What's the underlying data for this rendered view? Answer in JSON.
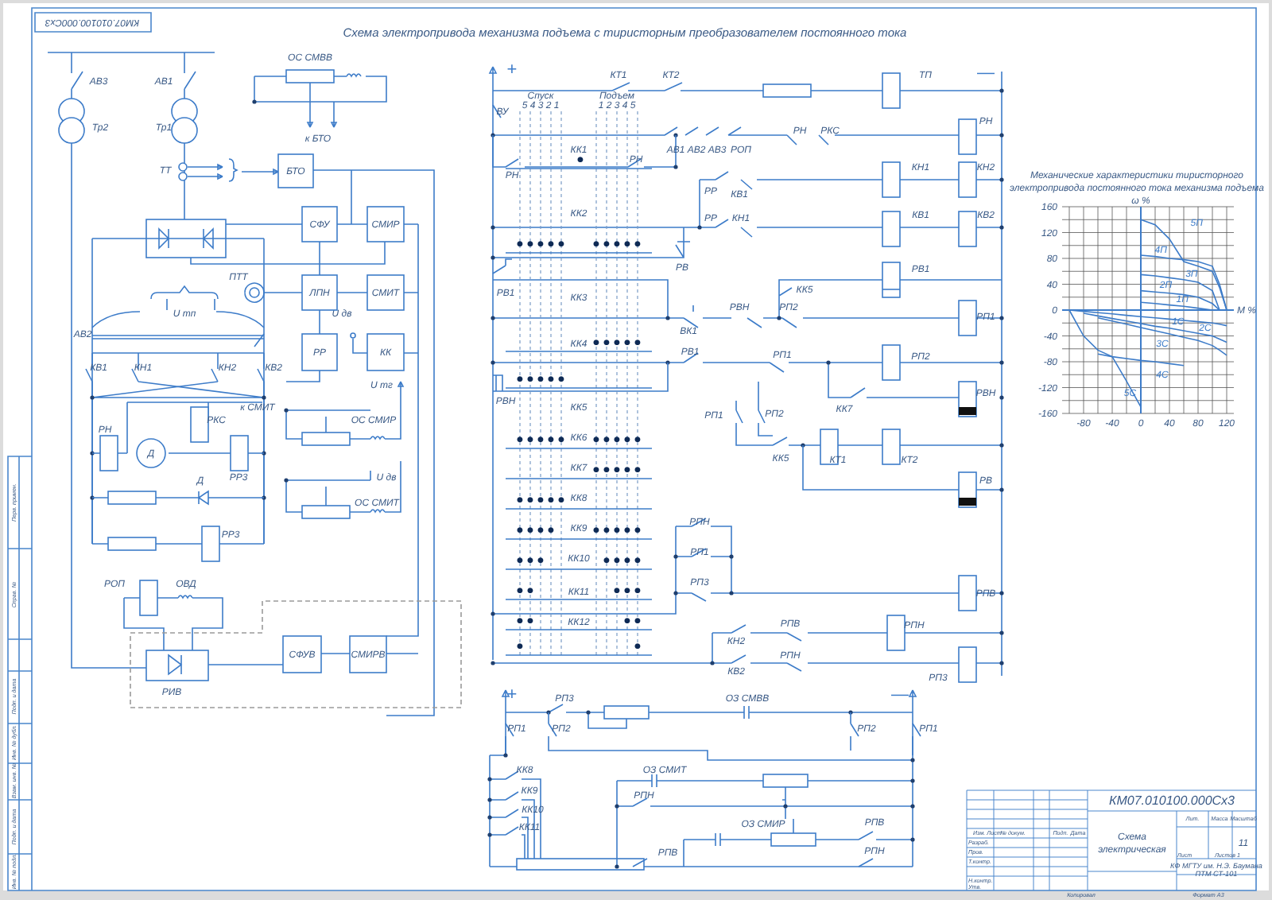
{
  "stamp_code": "КМ07.010100.000Сх3",
  "title": "Схема электропривода механизма подъема с тиристорным преобразователем постоянного тока",
  "power_circuit": {
    "labels": [
      "АВ3",
      "АВ1",
      "Тр2",
      "Тр1",
      "ОС СМВВ",
      "к БТО",
      "ТТ",
      "ПТТ",
      "U дв",
      "U тп",
      "U тг",
      "АВ2",
      "КВ1",
      "КН1",
      "КН2",
      "КВ2",
      "к СМИТ",
      "ОС СМИР",
      "РН",
      "РКС",
      "Д",
      "РР3",
      "Д",
      "U дв",
      "ОС СМИТ",
      "РР3",
      "РОП",
      "ОВД",
      "РИВ"
    ],
    "blocks": [
      "БТО",
      "СФУ",
      "СМИР",
      "ЛПН",
      "СМИТ",
      "РР",
      "КК",
      "СФУВ",
      "СМИРВ"
    ]
  },
  "control_circuit": {
    "terminals": [
      "+",
      "—"
    ],
    "labels": [
      "КТ1",
      "КТ2",
      "ТП",
      "ВУ",
      "АВ1",
      "АВ2",
      "АВ3",
      "РОП",
      "РН",
      "РКС",
      "РН",
      "РН",
      "РН",
      "КН1",
      "КН2",
      "РР",
      "КВ1",
      "РР",
      "КН1",
      "КВ1",
      "КВ2",
      "РВ",
      "РВ1",
      "РВ1",
      "КК5",
      "ВК1",
      "РВН",
      "РП2",
      "РП1",
      "РВ1",
      "РП1",
      "РП2",
      "РВН",
      "РВН",
      "КК7",
      "РП1",
      "РП2",
      "КК5",
      "КТ1",
      "КТ2",
      "РВ",
      "РПН",
      "РП1",
      "РП3",
      "РПВ",
      "КН2",
      "РПВ",
      "РПН",
      "КВ2",
      "РПН",
      "РП3"
    ],
    "controller": {
      "headers": [
        {
          "label": "Спуск",
          "positions": "5 4 3 2 1"
        },
        {
          "label": "Подъем",
          "positions": "1 2 3 4 5"
        }
      ],
      "rows": [
        {
          "label": "КК1",
          "neutral": "●"
        },
        {
          "label": "КК2",
          "lowering": "●●●●●",
          "hoisting": "●●●●●"
        },
        {
          "label": "КК3",
          "hoisting": "●●●●●"
        },
        {
          "label": "КК4",
          "lowering": "●●●●●"
        },
        {
          "label": "КК5",
          "lowering": "●●●●●",
          "hoisting": "●●●●●"
        },
        {
          "label": "КК6",
          "hoisting": "●●●●●"
        },
        {
          "label": "КК7",
          "lowering": "●●●●●"
        },
        {
          "label": "КК8",
          "lowering": "●●●●",
          "hoisting": "●●●●●"
        },
        {
          "label": "КК9",
          "lowering": "●●●",
          "hoisting": "●●●●"
        },
        {
          "label": "КК10",
          "lowering": "●●",
          "hoisting": "●●●"
        },
        {
          "label": "КК11",
          "lowering": "●●",
          "hoisting": "●●"
        },
        {
          "label": "КК12",
          "lowering": "●",
          "hoisting": "●"
        }
      ]
    }
  },
  "excitation_circuit": {
    "terminals": [
      "+",
      "—"
    ],
    "labels": [
      "РП3",
      "ОЗ СМВВ",
      "РП1",
      "РП2",
      "РП2",
      "РП1",
      "КК8",
      "КК9",
      "КК10",
      "КК11",
      "ОЗ СМИТ",
      "РПН",
      "ОЗ СМИР",
      "РПВ",
      "РПН",
      "РПВ"
    ]
  },
  "chart": {
    "chart_data": {
      "type": "line",
      "title": "Механические характеристики тиристорного электропривода постоянного тока механизма подъема",
      "xlabel": "М %",
      "ylabel": "ω %",
      "x": [
        -100,
        -80,
        -60,
        -40,
        -20,
        0,
        20,
        40,
        60,
        80,
        100,
        110,
        120
      ],
      "series": [
        {
          "name": "5П",
          "color": "#3d7cc9",
          "values": [
            null,
            null,
            null,
            null,
            null,
            140,
            132,
            110,
            75,
            68,
            60,
            35,
            0
          ]
        },
        {
          "name": "4П",
          "color": "#3d7cc9",
          "values": [
            null,
            null,
            null,
            null,
            null,
            85,
            83,
            80,
            78,
            75,
            68,
            40,
            0
          ]
        },
        {
          "name": "3П",
          "color": "#3d7cc9",
          "values": [
            null,
            null,
            null,
            null,
            null,
            55,
            53,
            50,
            47,
            43,
            30,
            0,
            null
          ]
        },
        {
          "name": "2П",
          "color": "#3d7cc9",
          "values": [
            null,
            null,
            null,
            null,
            null,
            30,
            28,
            26,
            24,
            20,
            10,
            0,
            null
          ]
        },
        {
          "name": "1П",
          "color": "#3d7cc9",
          "values": [
            null,
            null,
            null,
            null,
            null,
            12,
            10,
            8,
            6,
            3,
            0,
            null,
            null
          ]
        },
        {
          "name": "1С",
          "color": "#3d7cc9",
          "values": [
            0,
            -2,
            -4,
            -6,
            -8,
            -10,
            -12,
            -14,
            -16,
            -18,
            -20,
            -22,
            -24
          ]
        },
        {
          "name": "2С",
          "color": "#3d7cc9",
          "values": [
            null,
            -5,
            -9,
            -13,
            -17,
            -21,
            -25,
            -28,
            -32,
            -36,
            -40,
            -45,
            -50
          ]
        },
        {
          "name": "3С",
          "color": "#3d7cc9",
          "values": [
            null,
            null,
            -12,
            -17,
            -22,
            -27,
            -32,
            -37,
            -42,
            -47,
            -55,
            -62,
            -70
          ]
        },
        {
          "name": "4С",
          "color": "#3d7cc9",
          "values": [
            null,
            null,
            -68,
            -72,
            -75,
            -78,
            -80,
            -83,
            -86,
            null,
            null,
            null,
            null
          ]
        },
        {
          "name": "5С",
          "color": "#3d7cc9",
          "values": [
            0,
            -40,
            -62,
            -72,
            -110,
            -150,
            null,
            null,
            null,
            null,
            null,
            null,
            null
          ]
        }
      ],
      "grid": true,
      "xticks": [
        -80,
        -40,
        0,
        40,
        80,
        120
      ],
      "yticks": [
        -160,
        -120,
        -80,
        -40,
        0,
        40,
        80,
        120,
        160
      ],
      "xlim": [
        -110,
        130
      ],
      "ylim": [
        -160,
        160
      ]
    }
  },
  "title_block": {
    "code": "КМ07.010100.000Сх3",
    "name": [
      "Схема",
      "электрическая"
    ],
    "sheet": "11",
    "organization": [
      "КФ МГТУ им. Н.Э. Баумана",
      "ПТМ СТ-101"
    ],
    "labels": [
      "Изм. Лист",
      "№ докум.",
      "Подп.",
      "Дата",
      "Разраб.",
      "Пров.",
      "Т.контр.",
      "Н.контр.",
      "Утв.",
      "Лит.",
      "Масса",
      "Масштаб",
      "Лист",
      "Листов 1",
      "Копировал",
      "Формат А3"
    ]
  },
  "side_stamp": [
    "Перв. примен.",
    "Справ. №",
    "Подп. и дата",
    "Инв. № дубл.",
    "Взам. инв. №",
    "Подп. и дата",
    "Инв. № подл."
  ]
}
